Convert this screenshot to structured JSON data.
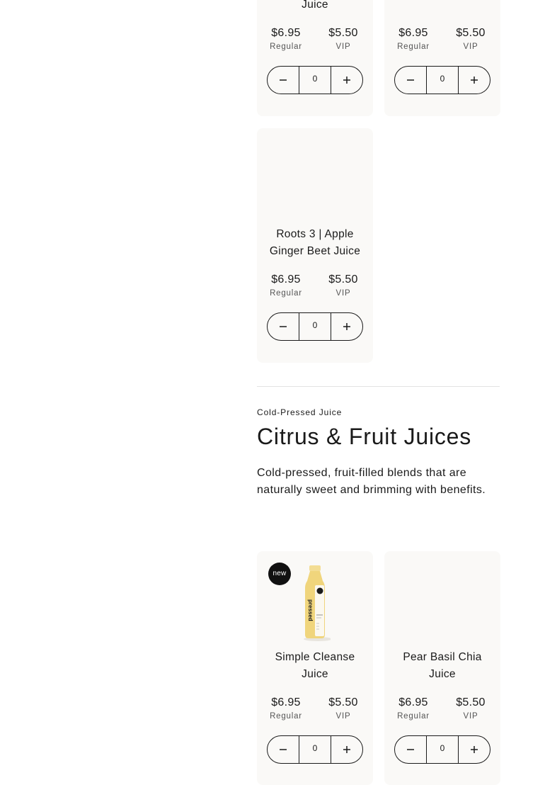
{
  "qty_controls": {
    "decrease_label": "−",
    "increase_label": "+"
  },
  "cards_top": [
    {
      "name": "Juice",
      "regular_price": "$6.95",
      "regular_label": "Regular",
      "vip_price": "$5.50",
      "vip_label": "VIP",
      "quantity": "0"
    },
    {
      "name": "",
      "regular_price": "$6.95",
      "regular_label": "Regular",
      "vip_price": "$5.50",
      "vip_label": "VIP",
      "quantity": "0"
    },
    {
      "name": "Roots 3 | Apple Ginger Beet Juice",
      "regular_price": "$6.95",
      "regular_label": "Regular",
      "vip_price": "$5.50",
      "vip_label": "VIP",
      "quantity": "0"
    }
  ],
  "section": {
    "eyebrow": "Cold-Pressed Juice",
    "title": "Citrus & Fruit Juices",
    "description": "Cold-pressed, fruit-filled blends that are naturally sweet and brimming with benefits."
  },
  "cards_bottom": [
    {
      "badge": "new",
      "image_icon": "juice-bottle-icon",
      "bottle_color": "#f0d57c",
      "bottle_brand": "pressed",
      "name": "Simple Cleanse Juice",
      "regular_price": "$6.95",
      "regular_label": "Regular",
      "vip_price": "$5.50",
      "vip_label": "VIP",
      "quantity": "0"
    },
    {
      "name": "Pear Basil Chia Juice",
      "regular_price": "$6.95",
      "regular_label": "Regular",
      "vip_price": "$5.50",
      "vip_label": "VIP",
      "quantity": "0"
    }
  ],
  "colors": {
    "card_background": "#faf9f7",
    "text": "#1a1a1a",
    "badge_background": "#111111"
  }
}
